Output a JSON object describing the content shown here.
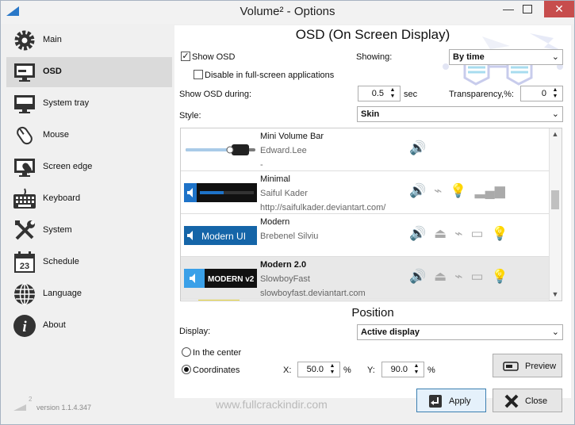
{
  "window": {
    "title": "Volume² - Options",
    "minimize": "—",
    "close": "✕"
  },
  "sidebar": {
    "items": [
      {
        "label": "Main",
        "icon": "gear-icon"
      },
      {
        "label": "OSD",
        "icon": "monitor-icon"
      },
      {
        "label": "System tray",
        "icon": "system-tray-icon"
      },
      {
        "label": "Mouse",
        "icon": "mouse-icon"
      },
      {
        "label": "Screen edge",
        "icon": "screen-edge-icon"
      },
      {
        "label": "Keyboard",
        "icon": "keyboard-icon"
      },
      {
        "label": "System",
        "icon": "tools-icon"
      },
      {
        "label": "Schedule",
        "icon": "calendar-icon"
      },
      {
        "label": "Language",
        "icon": "globe-icon"
      },
      {
        "label": "About",
        "icon": "info-icon"
      }
    ],
    "selected": "OSD",
    "calendar_day": "23"
  },
  "version": {
    "label": "version 1.1.4.347",
    "logo_superscript": "2"
  },
  "osd": {
    "title": "OSD (On Screen Display)",
    "show_osd": {
      "label": "Show OSD",
      "checked": true
    },
    "disable_fullscreen": {
      "label": "Disable in full-screen applications",
      "checked": false
    },
    "showing": {
      "label": "Showing:",
      "value": "By time"
    },
    "show_during": {
      "label": "Show OSD during:",
      "value": "0.5",
      "unit": "sec"
    },
    "transparency": {
      "label": "Transparency,%:",
      "value": "0"
    },
    "style": {
      "label": "Style:",
      "value": "Skin"
    }
  },
  "skins": [
    {
      "name": "Mini Volume Bar",
      "author": "Edward.Lee",
      "url": "-",
      "preview_text": "",
      "selected": false
    },
    {
      "name": "Minimal",
      "author": "Saiful Kader",
      "url": "http://saifulkader.deviantart.com/",
      "preview_text": "",
      "selected": false
    },
    {
      "name": "Modern",
      "author": "Brebenel Silviu",
      "url": "",
      "preview_text": "Modern UI",
      "selected": false
    },
    {
      "name": "Modern 2.0",
      "author": "SlowboyFast",
      "url": "slowboyfast.deviantart.com",
      "preview_text": "MODERN v2",
      "selected": true
    }
  ],
  "position": {
    "title": "Position",
    "display": {
      "label": "Display:",
      "value": "Active display"
    },
    "center": {
      "label": "In the center",
      "selected": false
    },
    "coordinates": {
      "label": "Coordinates",
      "selected": true
    },
    "x": {
      "label": "X:",
      "value": "50.0",
      "unit": "%"
    },
    "y": {
      "label": "Y:",
      "value": "90.0",
      "unit": "%"
    }
  },
  "buttons": {
    "preview": "Preview",
    "apply": "Apply",
    "close": "Close"
  },
  "watermark": "www.fullcrackindir.com",
  "colors": {
    "accent_blue": "#1e73c8",
    "close_red": "#c74d4d",
    "selected_bg": "#dadada"
  }
}
